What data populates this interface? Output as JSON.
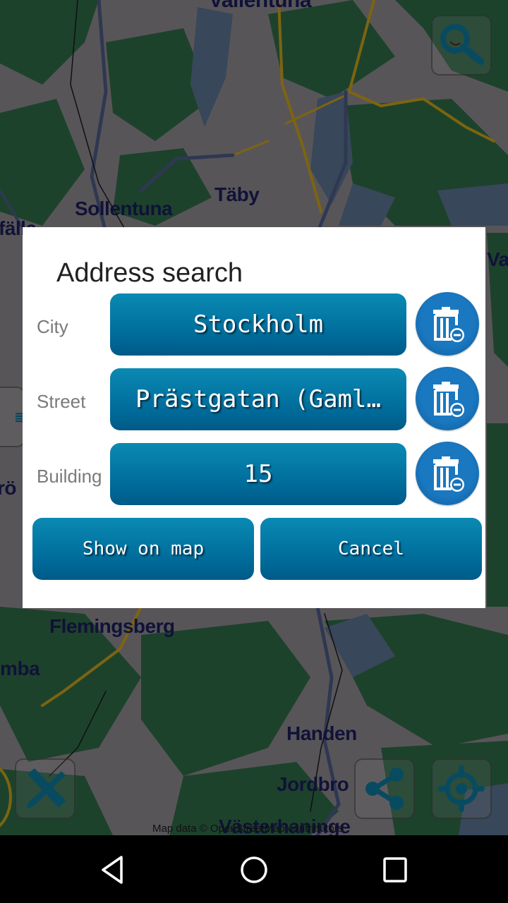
{
  "map": {
    "place_labels": [
      {
        "name": "Vallentuna"
      },
      {
        "name": "Täby"
      },
      {
        "name": "Sollentuna"
      },
      {
        "name": "fälla"
      },
      {
        "name": "Vax"
      },
      {
        "name": "rö"
      },
      {
        "name": "Flemingsberg"
      },
      {
        "name": "mba"
      },
      {
        "name": "Handen"
      },
      {
        "name": "Jordbro"
      },
      {
        "name": "Västerhaninge"
      }
    ],
    "attribution": "Map data © OpenStreetMap contributors",
    "controls": {
      "search": {
        "icon": "magnifier-icon"
      },
      "measure": {
        "icon": "ruler-pencil-icon"
      },
      "share": {
        "icon": "share-icon"
      },
      "locate": {
        "icon": "crosshair-icon"
      },
      "layers": {
        "icon": "menu-lines-icon"
      }
    },
    "colors": {
      "forest": "#2f6b47",
      "land": "#8f8a90",
      "water": "#5b7391",
      "road_major": "#c9a21a",
      "road": "#4d5b83",
      "label": "#1b1e5a"
    }
  },
  "dialog": {
    "title": "Address search",
    "fields": [
      {
        "label": "City",
        "value": "Stockholm",
        "clear_icon": "trash-minus-icon"
      },
      {
        "label": "Street",
        "value": "Prästgatan (Gaml…",
        "clear_icon": "trash-minus-icon"
      },
      {
        "label": "Building",
        "value": "15",
        "clear_icon": "trash-minus-icon"
      }
    ],
    "buttons": {
      "show_on_map": "Show on map",
      "cancel": "Cancel"
    },
    "colors": {
      "button": "#0a7aa8",
      "clear_button": "#1a6fb5"
    }
  },
  "navbar": {
    "back": "back-icon",
    "home": "home-icon",
    "recents": "recents-icon"
  }
}
